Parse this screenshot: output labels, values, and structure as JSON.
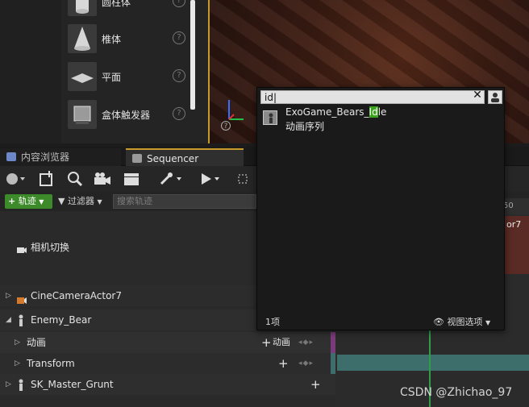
{
  "place_actors": {
    "items": [
      {
        "label": "圆柱体",
        "icon": "cylinder-icon"
      },
      {
        "label": "椎体",
        "icon": "cone-icon"
      },
      {
        "label": "平面",
        "icon": "plane-icon"
      },
      {
        "label": "盒体触发器",
        "icon": "box-trigger-icon"
      }
    ],
    "help_glyph": "?"
  },
  "tabs": {
    "content_browser": "内容浏览器",
    "sequencer": "Sequencer"
  },
  "toolbar": {
    "add_track": "轨迹",
    "filters": "过滤器",
    "search_placeholder": "搜索轨迹"
  },
  "tracks": {
    "camera_cuts": "相机切换",
    "cine_camera": "CineCameraActor7",
    "enemy_bear": "Enemy_Bear",
    "animation": "动画",
    "animation_add": "动画",
    "transform": "Transform",
    "sk_master": "SK_Master_Grunt"
  },
  "timeline": {
    "ruler_label": "50",
    "actor_label": "or7"
  },
  "popup": {
    "search_value": "id",
    "result": {
      "name_before": "ExoGame_Bears_",
      "name_match": "Id",
      "name_after": "le",
      "type": "动画序列"
    },
    "count": "1项",
    "view_options": "视图选项"
  },
  "watermark": "CSDN @Zhichao_97",
  "colors": {
    "accent": "#c89a2a",
    "add_green": "#3d8a2a",
    "highlight": "#3ca31e",
    "playhead": "#2e9f48"
  }
}
